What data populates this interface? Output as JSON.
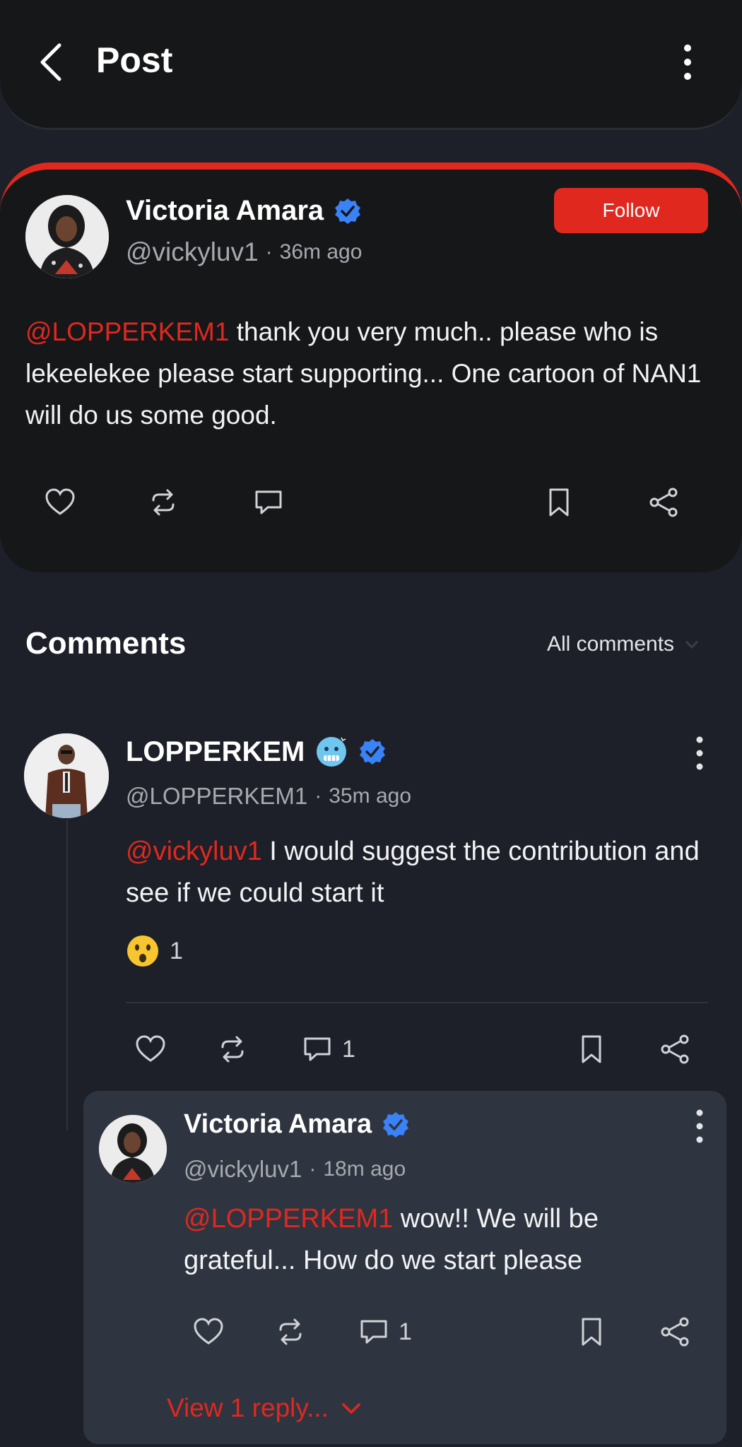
{
  "header": {
    "title": "Post"
  },
  "post": {
    "author_name": "Victoria Amara",
    "handle": "@vickyluv1",
    "time": "36m ago",
    "follow_label": "Follow",
    "mention": "@LOPPERKEM1",
    "text": " thank you very much.. please who is lekeelekee please start supporting... One cartoon of NAN1 will do us some good."
  },
  "comments_section": {
    "title": "Comments",
    "sort_label": "All comments"
  },
  "comment": {
    "author_name": "LOPPERKEM",
    "handle": "@LOPPERKEM1",
    "time": "35m ago",
    "mention": "@vickyluv1",
    "text": " I would suggest the contribution and see if we could start it",
    "reaction_count": "1",
    "reply_count": "1"
  },
  "reply": {
    "author_name": "Victoria Amara",
    "handle": "@vickyluv1",
    "time": "18m ago",
    "mention": "@LOPPERKEM1",
    "text": " wow!! We will be grateful... How do we start please",
    "reply_count": "1",
    "view_replies_label": "View 1 reply..."
  },
  "separator": "·",
  "icons": [
    "back-arrow-icon",
    "more-vertical-icon",
    "verified-badge-icon",
    "cold-face-emoji-icon",
    "astonished-emoji-icon",
    "heart-icon",
    "repost-icon",
    "comment-icon",
    "bookmark-icon",
    "share-icon",
    "chevron-down-icon"
  ],
  "colors": {
    "accent": "#e0281f",
    "verified": "#3a82f7",
    "background": "#1d2028",
    "card": "#161719",
    "reply_card": "#2f3540"
  }
}
